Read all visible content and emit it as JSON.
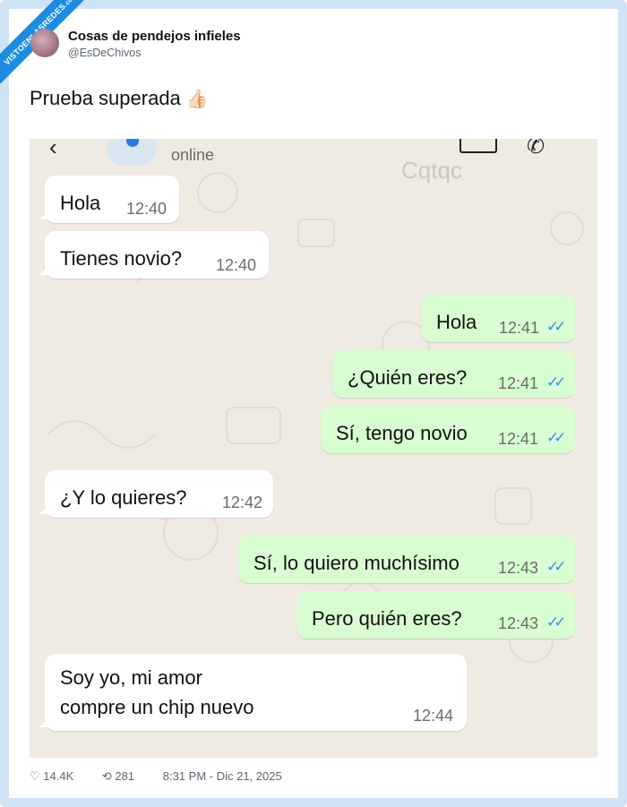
{
  "site_ribbon": {
    "main": "VISTOENLASREDES",
    "sub": ".com"
  },
  "post": {
    "author_name": "Cosas de pendejos infieles",
    "author_handle": "@EsDeChivos",
    "text": "Prueba superada",
    "emoji": "👍🏻"
  },
  "chat": {
    "status": "online",
    "watermark": "Cqtqc",
    "icons": [
      "back-arrow-icon",
      "video-call-icon",
      "phone-icon"
    ],
    "messages": [
      {
        "direction": "in",
        "text": "Hola",
        "time": "12:40"
      },
      {
        "direction": "in",
        "text": "Tienes novio?",
        "time": "12:40"
      },
      {
        "direction": "out",
        "text": "Hola",
        "time": "12:41",
        "status": "read"
      },
      {
        "direction": "out",
        "text": "¿Quién eres?",
        "time": "12:41",
        "status": "read"
      },
      {
        "direction": "out",
        "text": "Sí, tengo novio",
        "time": "12:41",
        "status": "read"
      },
      {
        "direction": "in",
        "text": "¿Y lo quieres?",
        "time": "12:42"
      },
      {
        "direction": "out",
        "text": "Sí, lo quiero muchísimo",
        "time": "12:43",
        "status": "read"
      },
      {
        "direction": "out",
        "text": "Pero quién eres?",
        "time": "12:43",
        "status": "read"
      },
      {
        "direction": "in",
        "text": "Soy yo, mi amor\ncompre un chip nuevo",
        "time": "12:44"
      }
    ],
    "colors": {
      "incoming": "#ffffff",
      "outgoing": "#d8fdd2",
      "read_ticks": "#3a8fe8",
      "background": "#efeae2"
    }
  },
  "footer": {
    "likes": "14.4K",
    "retweets": "281",
    "timestamp": "8:31 PM - Dic 21, 2025"
  }
}
